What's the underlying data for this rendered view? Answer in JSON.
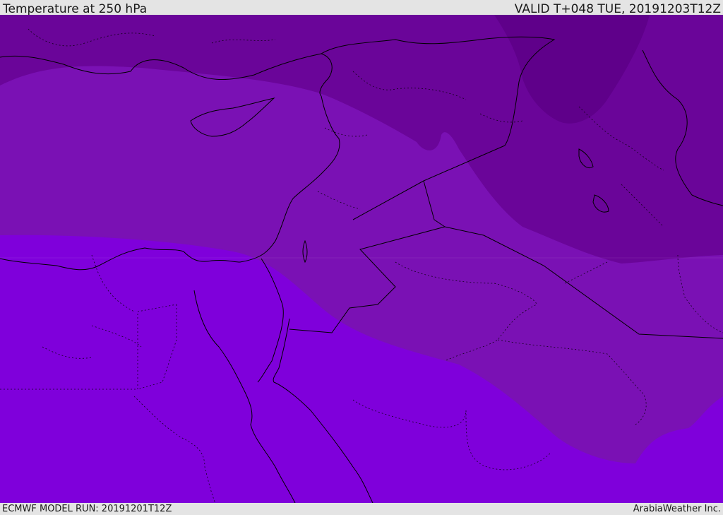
{
  "header": {
    "title": "Temperature at 250 hPa",
    "valid": "VALID T+048 TUE, 20191203T12Z"
  },
  "footer": {
    "model_run": "ECMWF MODEL RUN: 20191201T12Z",
    "credit": "ArabiaWeather Inc."
  },
  "colors": {
    "band_warmest": "#7f00db",
    "band_warm": "#7a11b4",
    "band_cool": "#6a0599",
    "band_cold": "#5f008a",
    "coastline": "#000000",
    "background": "#e4e4e4"
  }
}
